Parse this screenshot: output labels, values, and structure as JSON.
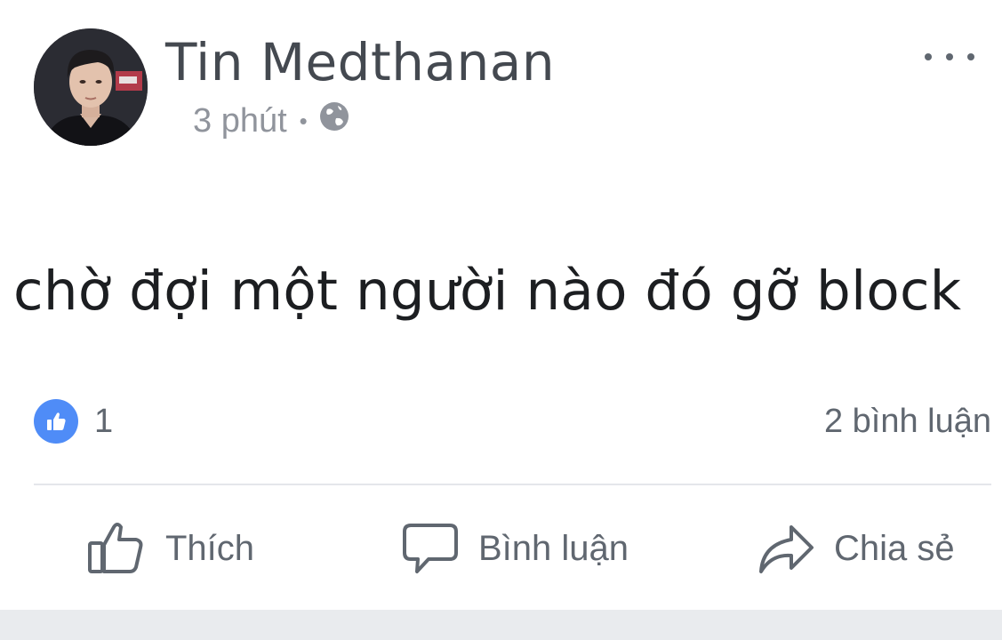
{
  "post": {
    "author": "Tin Medthanan",
    "time": "3 phút",
    "separator": "•",
    "privacy_icon": "globe-icon",
    "text": "chờ đợi một người nào đó gỡ block",
    "reaction_count": "1",
    "comment_count": "2 bình luận"
  },
  "actions": {
    "like_label": "Thích",
    "comment_label": "Bình luận",
    "share_label": "Chia sẻ"
  },
  "colors": {
    "like_blue": "#4f8cf7",
    "secondary_text": "#606770",
    "meta_text": "#90949c"
  }
}
